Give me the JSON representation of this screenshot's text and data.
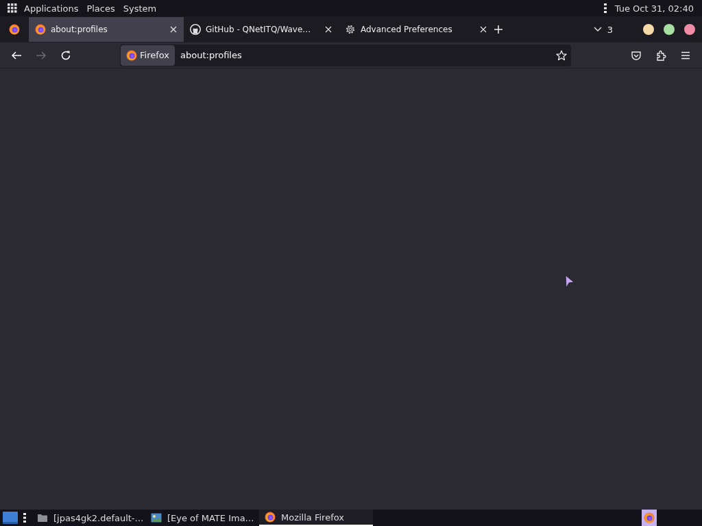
{
  "top_panel": {
    "menus": [
      "Applications",
      "Places",
      "System"
    ],
    "clock": "Tue Oct 31, 02:40"
  },
  "tabs": [
    {
      "label": "about:profiles",
      "kind": "firefox",
      "selected": true
    },
    {
      "label": "GitHub - QNetITQ/Wave…",
      "kind": "github",
      "selected": false
    },
    {
      "label": "Advanced Preferences",
      "kind": "gear",
      "selected": false
    }
  ],
  "tab_count": "3",
  "window_buttons": [
    {
      "color": "#f6d9a9"
    },
    {
      "color": "#a5e0a0"
    },
    {
      "color": "#f08ca6"
    }
  ],
  "nav": {
    "back_disabled": false,
    "forward_disabled": true
  },
  "url_bar": {
    "identity": "Firefox",
    "value": "about:profiles"
  },
  "taskbar": {
    "items": [
      {
        "label": "[jpas4gk2.default-…",
        "kind": "folder",
        "selected": false
      },
      {
        "label": "[Eye of MATE Ima…",
        "kind": "image",
        "selected": false
      },
      {
        "label": "Mozilla Firefox",
        "kind": "firefox",
        "selected": true
      }
    ]
  }
}
